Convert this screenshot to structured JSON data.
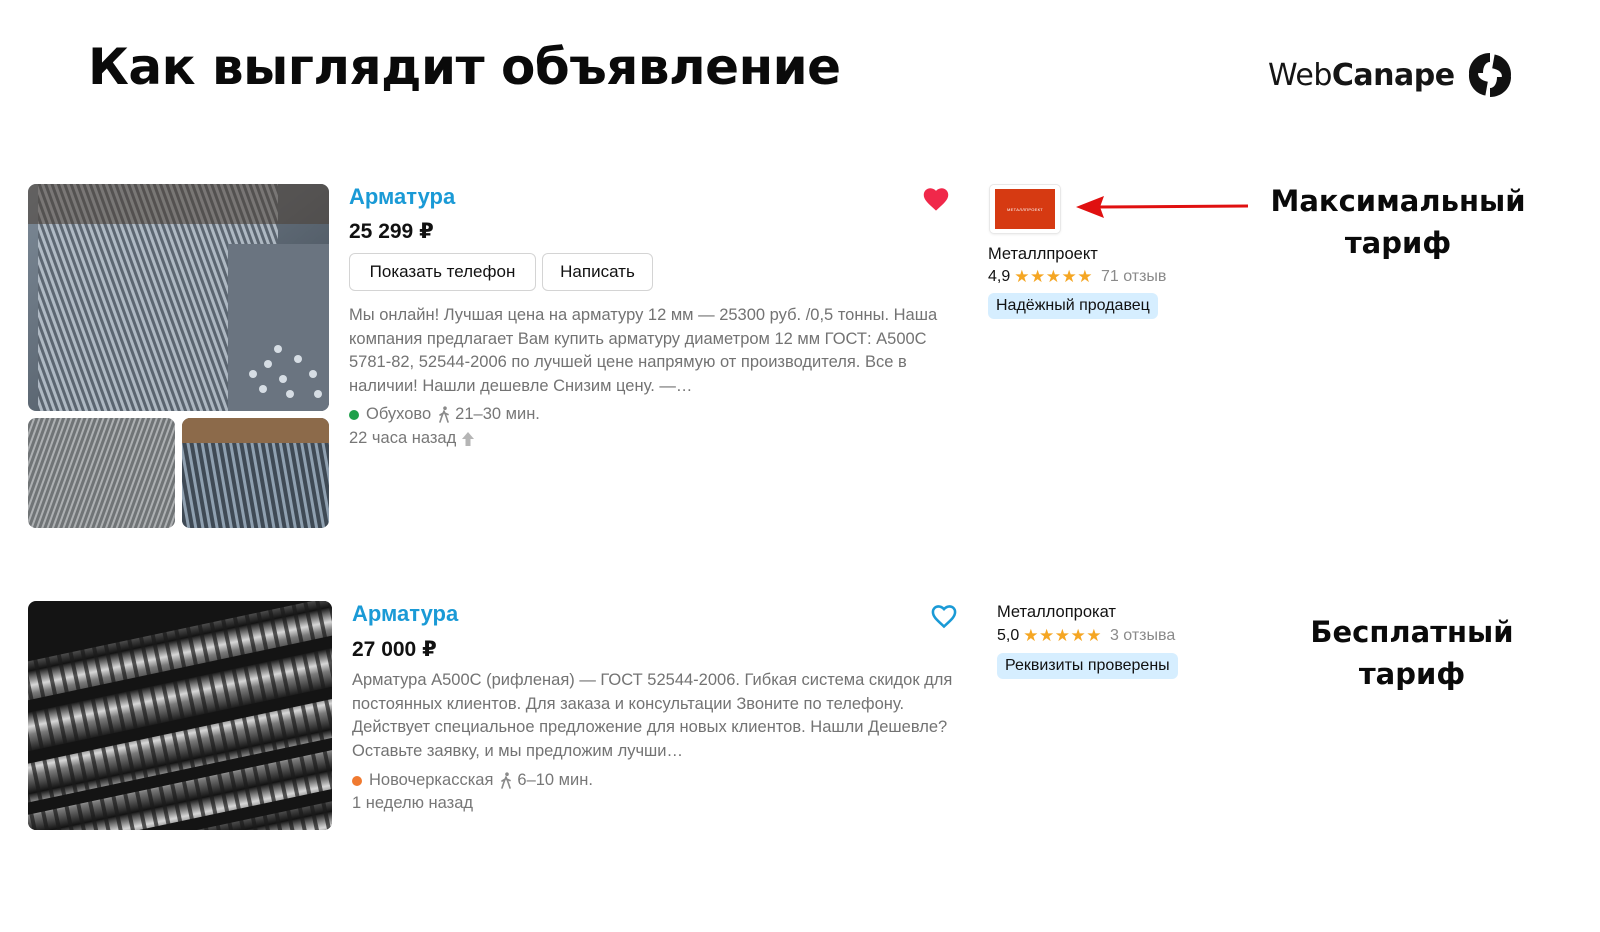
{
  "header": {
    "title": "Как выглядит объявление",
    "brand_light": "Web",
    "brand_bold": "Canape"
  },
  "listings": [
    {
      "title": "Арматура",
      "price": "25 299 ₽",
      "show_phone_label": "Показать телефон",
      "message_label": "Написать",
      "description": "Мы онлайн! Лучшая цена на арматуру 12 мм — 25300 руб. /0,5 тонны. Наша компания предлагает Вам купить арматуру диаметром 12 мм ГОСТ: А500С 5781-82, 52544-2006 по лучшей цене напрямую от производителя. Все в наличии! Нашли дешевле Снизим цену. —…",
      "metro": "Обухово",
      "metro_color": "#1ea04a",
      "walk_time": "21–30 мин.",
      "posted": "22 часа назад",
      "favorite": true,
      "seller": {
        "logo_text": "МЕТАЛЛПРОЕКТ",
        "name": "Металлпроект",
        "rating": "4,9",
        "stars": "★★★★★",
        "reviews": "71 отзыв",
        "badge": "Надёжный продавец"
      },
      "tariff_line1": "Максимальный",
      "tariff_line2": "тариф"
    },
    {
      "title": "Арматура",
      "price": "27 000 ₽",
      "description": "Арматура А500С (рифленая) — ГОСТ 52544-2006. Гибкая система скидок для постоянных клиентов. Для заказа и консультации Звоните по телефону. Действует специальное предложение для новых клиентов. Нашли Дешевле? Оставьте заявку, и мы предложим лучши…",
      "metro": "Новочеркасская",
      "metro_color": "#f07a30",
      "walk_time": "6–10 мин.",
      "posted": "1 неделю назад",
      "favorite": false,
      "seller": {
        "name": "Металлопрокат",
        "rating": "5,0",
        "stars": "★★★★★",
        "reviews": "3 отзыва",
        "badge": "Реквизиты проверены"
      },
      "tariff_line1": "Бесплатный",
      "tariff_line2": "тариф"
    }
  ],
  "colors": {
    "link_blue": "#1a9ad6",
    "heart_red": "#f0284a",
    "arrow_red": "#e01010",
    "badge_bg": "#d6eeff",
    "star": "#f5a623"
  }
}
